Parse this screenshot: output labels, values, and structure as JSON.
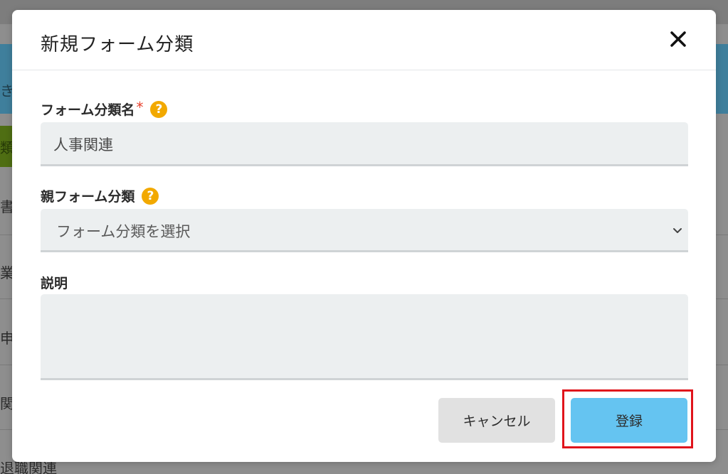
{
  "background": {
    "blue_text": "き",
    "green_text": "類",
    "rows": [
      "書関",
      "業務",
      "申次",
      "関連",
      "退職関連"
    ]
  },
  "modal": {
    "title": "新規フォーム分類",
    "close_icon": "close-icon",
    "fields": {
      "name": {
        "label": "フォーム分類名",
        "required_mark": "*",
        "help": "?",
        "value": "人事関連"
      },
      "parent": {
        "label": "親フォーム分類",
        "help": "?",
        "selected": "フォーム分類を選択"
      },
      "description": {
        "label": "説明",
        "value": ""
      }
    },
    "buttons": {
      "cancel": "キャンセル",
      "submit": "登録"
    }
  },
  "colors": {
    "help_icon": "#f2a900",
    "required_star": "#e8412d",
    "submit_button": "#65c4f1",
    "highlight": "#e0141c"
  }
}
